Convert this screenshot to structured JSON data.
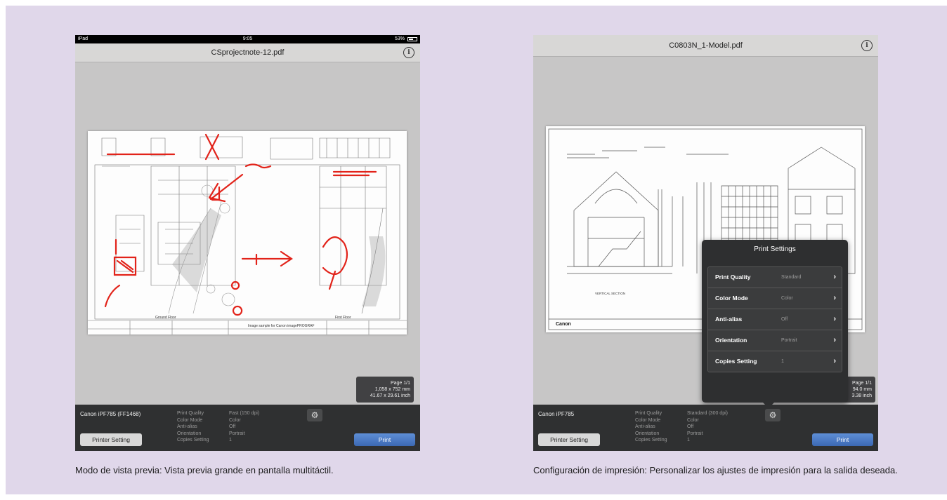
{
  "left_screen": {
    "status_bar": {
      "device": "iPad",
      "time": "9:05",
      "battery": "53%"
    },
    "file_title": "CSprojectnote-12.pdf",
    "drawing_sheet": {
      "label_left": "Ground Floor",
      "label_right": "First Floor",
      "footer_text": "Image sample for Canon imagePROGRAF"
    },
    "page_info": {
      "page": "Page 1/1",
      "size_mm": "1,058 x 752 mm",
      "size_inch": "41.67 x 29.61 inch"
    },
    "bottom_bar": {
      "printer_name": "Canon iPF785 (FF1468)",
      "settings_labels": [
        "Print Quality",
        "Color Mode",
        "Anti-alias",
        "Orientation",
        "Copies Setting"
      ],
      "settings_values": [
        "Fast (150 dpi)",
        "Color",
        "Off",
        "Portrait",
        "1"
      ],
      "printer_setting_button": "Printer Setting",
      "print_button": "Print"
    }
  },
  "right_screen": {
    "file_title": "C0803N_1-Model.pdf",
    "drawing_sheet": {
      "section_label": "VERTICAL SECTION",
      "logo_text": "Canon"
    },
    "page_info": {
      "page": "Page 1/1",
      "size_mm": "94.0 mm",
      "size_inch": "3.38 inch"
    },
    "popover": {
      "title": "Print Settings",
      "rows": [
        {
          "label": "Print Quality",
          "value": "Standard"
        },
        {
          "label": "Color Mode",
          "value": "Color"
        },
        {
          "label": "Anti-alias",
          "value": "Off"
        },
        {
          "label": "Orientation",
          "value": "Portrait"
        },
        {
          "label": "Copies Setting",
          "value": "1"
        }
      ]
    },
    "bottom_bar": {
      "printer_name": "Canon iPF785",
      "settings_labels": [
        "Print Quality",
        "Color Mode",
        "Anti-alias",
        "Orientation",
        "Copies Setting"
      ],
      "settings_values": [
        "Standard (300 dpi)",
        "Color",
        "Off",
        "Portrait",
        "1"
      ],
      "printer_setting_button": "Printer Setting",
      "print_button": "Print"
    }
  },
  "captions": {
    "left": "Modo de vista previa: Vista previa grande en pantalla multitáctil.",
    "right": "Configuración de impresión: Personalizar los ajustes de impresión para la salida deseada."
  },
  "colors": {
    "background": "#e0d7ea",
    "annotation_red": "#e2231a",
    "print_button": "#4a78c4"
  },
  "icons": {
    "info": "info-circle-icon",
    "gear": "gear-icon",
    "chevron": "chevron-right-icon"
  }
}
